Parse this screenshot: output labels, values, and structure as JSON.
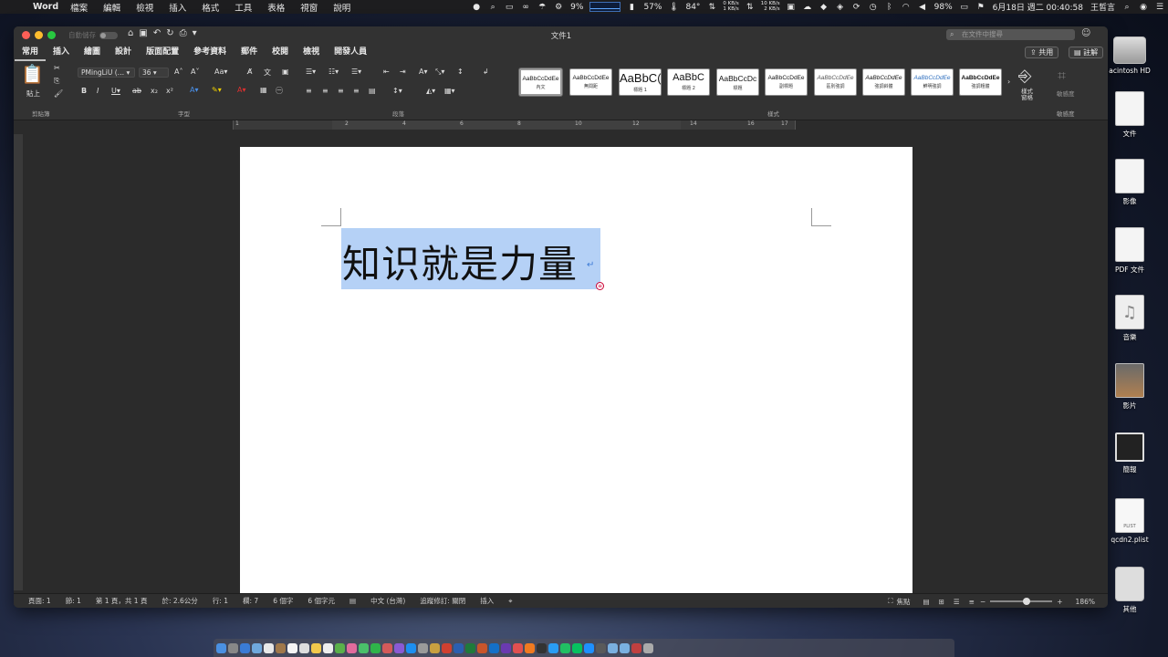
{
  "menubar": {
    "app_name": "Word",
    "items": [
      "檔案",
      "編輯",
      "檢視",
      "插入",
      "格式",
      "工具",
      "表格",
      "視窗",
      "說明"
    ],
    "cpu": "9%",
    "battery_small": "57%",
    "temp": "84°",
    "net_up": "0 KB/s",
    "net_down": "1 KB/s",
    "net2_up": "10 KB/s",
    "net2_down": "2 KB/s",
    "battery": "98%",
    "clock": "6月18日 週二 00:40:58",
    "user": "王皙言"
  },
  "window": {
    "autosave_label": "自動儲存",
    "title": "文件1",
    "search_placeholder": "在文件中搜尋",
    "share_label": "共用",
    "comments_label": "註解"
  },
  "tabs": [
    "常用",
    "插入",
    "繪圖",
    "設計",
    "版面配置",
    "參考資料",
    "郵件",
    "校閱",
    "檢視",
    "開發人員"
  ],
  "ribbon": {
    "paste_label": "貼上",
    "clipboard_label": "剪貼簿",
    "font_name": "PMingLiU (…",
    "font_size": "36",
    "font_group_label": "字型",
    "paragraph_group_label": "段落",
    "styles_group_label": "樣式",
    "styles_pane_label": "樣式窗格",
    "sensitivity_label": "敏感度",
    "styles": [
      {
        "sample": "AaBbCcDdEe",
        "name": "內文"
      },
      {
        "sample": "AaBbCcDdEe",
        "name": "無間距"
      },
      {
        "sample": "AaBbC(",
        "name": "標題 1"
      },
      {
        "sample": "AaBbC",
        "name": "標題 2"
      },
      {
        "sample": "AaBbCcDc",
        "name": "標題"
      },
      {
        "sample": "AaBbCcDdEe",
        "name": "副標題"
      },
      {
        "sample": "AaBbCcDdEe",
        "name": "區別強調"
      },
      {
        "sample": "AaBbCcDdEe",
        "name": "強調斜體"
      },
      {
        "sample": "AaBbCcDdEe",
        "name": "鮮明強調"
      },
      {
        "sample": "AaBbCcDdEe",
        "name": "強調粗體"
      }
    ]
  },
  "ruler_numbers": [
    "1",
    "2",
    "4",
    "6",
    "8",
    "10",
    "12",
    "14",
    "16",
    "17"
  ],
  "document": {
    "text": "知识就是力量"
  },
  "status": {
    "page": "頁面: 1",
    "section": "節: 1",
    "page_of": "第 1 頁，共 1 頁",
    "at": "於: 2.6公分",
    "line": "行: 1",
    "column": "欄: 7",
    "words": "6 個字",
    "chars": "6 個字元",
    "language": "中文 (台灣)",
    "track_changes": "追蹤修訂: 關閉",
    "insert": "插入",
    "focus": "焦點",
    "zoom": "186%"
  },
  "desktop": {
    "icons": [
      {
        "label": "acintosh HD",
        "kind": "drive"
      },
      {
        "label": "文件",
        "kind": "folder"
      },
      {
        "label": "影像",
        "kind": "folder"
      },
      {
        "label": "PDF 文件",
        "kind": "folder"
      },
      {
        "label": "音樂",
        "kind": "music"
      },
      {
        "label": "影片",
        "kind": "photo"
      },
      {
        "label": "簡報",
        "kind": "dark"
      },
      {
        "label": "qcdn2.plist",
        "kind": "plist"
      },
      {
        "label": "其他",
        "kind": "other"
      }
    ]
  },
  "colors": {
    "selection": "#b5d1f6",
    "ribbon_bg": "#323232",
    "window_bg": "#2b2b2b"
  }
}
